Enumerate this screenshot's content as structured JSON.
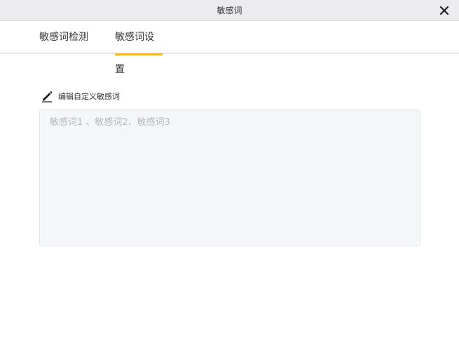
{
  "window": {
    "title": "敏感词",
    "close_icon": "close-icon"
  },
  "tabs": [
    {
      "label": "敏感词检测",
      "active": false
    },
    {
      "label": "敏感词设置",
      "active": true
    }
  ],
  "colors": {
    "accent": "#f5b52e",
    "titlebar_bg": "#ececee",
    "editor_bg": "#f5f6fa"
  },
  "editor": {
    "label": "编辑自定义敏感词",
    "label_icon": "pencil-icon",
    "value": "",
    "placeholder": "敏感词1 、敏感词2、敏感词3"
  }
}
